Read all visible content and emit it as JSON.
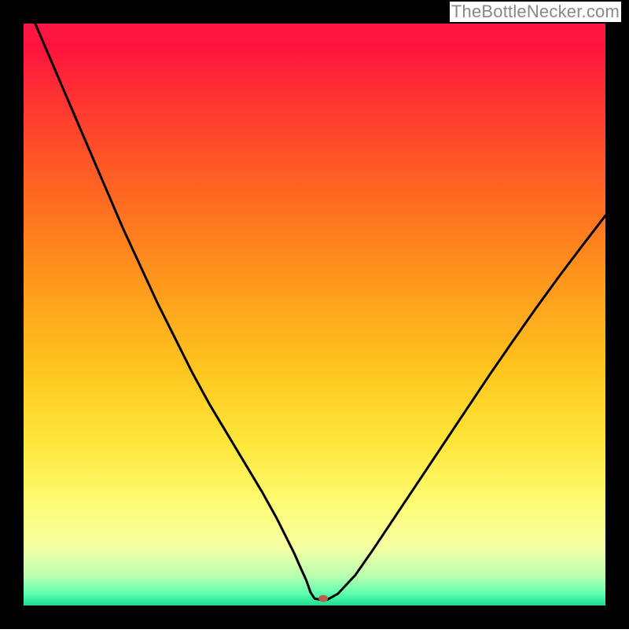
{
  "watermark": "TheBottleNecker.com",
  "chart_data": {
    "type": "line",
    "title": "",
    "xlabel": "",
    "ylabel": "",
    "xlim": [
      0,
      100
    ],
    "ylim": [
      0,
      100
    ],
    "border_px": 30,
    "gradient_stops": [
      {
        "offset": 0.0,
        "color": "#ff1744"
      },
      {
        "offset": 0.04,
        "color": "#ff143f"
      },
      {
        "offset": 0.15,
        "color": "#ff3a2f"
      },
      {
        "offset": 0.3,
        "color": "#ff6a21"
      },
      {
        "offset": 0.45,
        "color": "#ff9a1c"
      },
      {
        "offset": 0.6,
        "color": "#ffc71f"
      },
      {
        "offset": 0.72,
        "color": "#ffe63a"
      },
      {
        "offset": 0.82,
        "color": "#fffb72"
      },
      {
        "offset": 0.9,
        "color": "#f5ffa3"
      },
      {
        "offset": 0.95,
        "color": "#b8ffb0"
      },
      {
        "offset": 0.98,
        "color": "#5cffb0"
      },
      {
        "offset": 1.0,
        "color": "#18e08f"
      }
    ],
    "series": [
      {
        "name": "bottleneck-curve",
        "x": [
          2.0,
          5,
          8,
          11,
          14,
          17,
          20,
          23,
          26,
          29,
          32,
          35,
          38,
          41,
          43.5,
          45,
          46.5,
          47.6,
          48.6,
          49.3,
          50.0,
          51.0,
          52.2,
          54,
          57,
          60,
          64,
          68,
          72,
          76,
          80,
          84,
          88,
          92,
          96,
          100
        ],
        "y": [
          100,
          93,
          86,
          79,
          72,
          65,
          58.5,
          52,
          46,
          40,
          34.5,
          29.5,
          24.5,
          19.5,
          15,
          12,
          9,
          6.5,
          4.3,
          2.3,
          1.2,
          1.0,
          1.0,
          2.0,
          5.2,
          9.5,
          15.5,
          21.5,
          27.5,
          33.5,
          39.5,
          45.3,
          51,
          56.5,
          61.8,
          67
        ]
      }
    ],
    "marker": {
      "x": 51.5,
      "y": 1.2,
      "rx": 6,
      "ry": 4.5,
      "fill": "#c05a4a"
    }
  }
}
